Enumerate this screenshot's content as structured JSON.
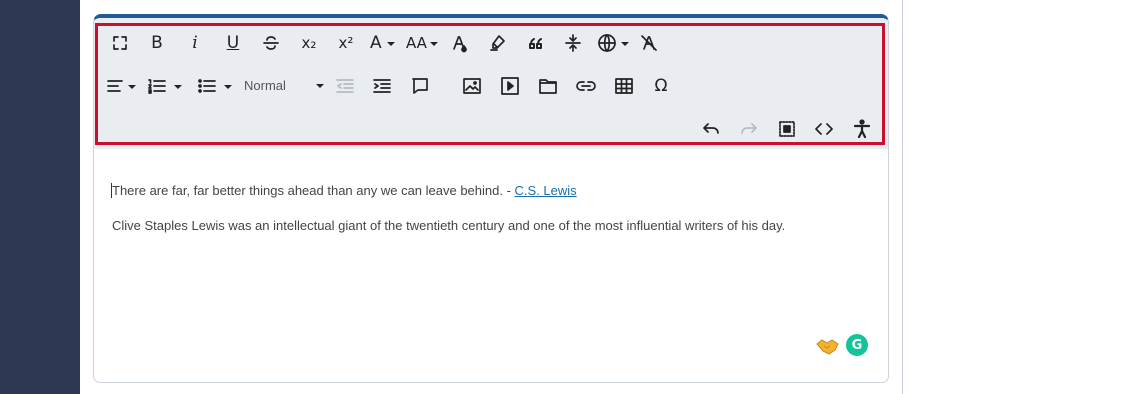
{
  "toolbar": {
    "row1": [
      "fullscreen",
      "bold",
      "italic",
      "underline",
      "strikethrough",
      "subscript",
      "superscript",
      "font-size",
      "font-family",
      "text-color",
      "highlight",
      "quote",
      "page-break",
      "language",
      "clear-format"
    ],
    "bold_label": "B",
    "italic_label": "i",
    "underline_label": "U",
    "subscript_label": "x₂",
    "superscript_label": "x²",
    "fontsize_label": "A",
    "fontfamily_label": "AA",
    "quote_label": "66",
    "omega_label": "Ω",
    "format_value": "Normal"
  },
  "content": {
    "line1_text": "There are far, far better things ahead than any we can leave behind. - ",
    "line1_link": "C.S. Lewis",
    "line2_text": "Clive Staples Lewis was an intellectual giant of the twentieth century and one of the most influential writers of his day."
  },
  "grammarly_label": "G",
  "colors": {
    "sidebar": "#2d3752",
    "toolbar_bg": "#e9edf1",
    "highlight_border": "#c8102e",
    "link": "#1a6fa8",
    "editor_top_border": "#1f5b95",
    "grammarly": "#15c39a"
  }
}
